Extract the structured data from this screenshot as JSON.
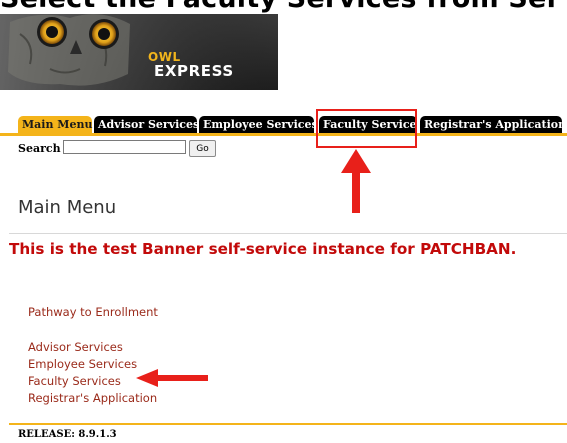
{
  "header": {
    "cropped_heading": "Select the Faculty Services from Ser",
    "brand_line1": "OWL",
    "brand_line2": "EXPRESS"
  },
  "tabs": [
    {
      "label": "Main Menu",
      "active": true
    },
    {
      "label": "Advisor Services",
      "active": false
    },
    {
      "label": "Employee Services",
      "active": false
    },
    {
      "label": "Faculty Services",
      "active": false
    },
    {
      "label": "Registrar's Application",
      "active": false
    }
  ],
  "search": {
    "label": "Search",
    "value": "",
    "button_label": "Go"
  },
  "main": {
    "title": "Main Menu",
    "notice": "This is the test Banner self-service instance for PATCHBAN.",
    "links": [
      "Pathway to Enrollment",
      "Advisor Services",
      "Employee Services",
      "Faculty Services",
      "Registrar's Application"
    ]
  },
  "footer": {
    "release": "RELEASE: 8.9.1.3"
  },
  "colors": {
    "tab_active": "#f4b41a",
    "tab_inactive": "#000000",
    "notice_text": "#c20a0a",
    "link_text": "#9a2a1a",
    "annotation": "#e8201a"
  }
}
